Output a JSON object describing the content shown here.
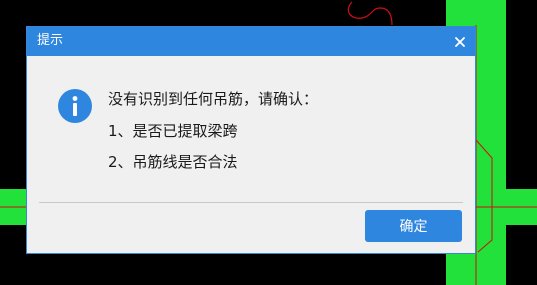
{
  "dialog": {
    "title": "提示",
    "messages": [
      "没有识别到任何吊筋，请确认：",
      "1、是否已提取梁跨",
      "2、吊筋线是否合法"
    ],
    "ok_label": "确定"
  },
  "icons": {
    "info": "info-icon",
    "close": "close-icon"
  },
  "colors": {
    "accent": "#2f86df",
    "dialog_bg": "#f0f0f0",
    "cad_green": "#22e13a",
    "cad_red": "#d01010",
    "background": "#000000"
  }
}
